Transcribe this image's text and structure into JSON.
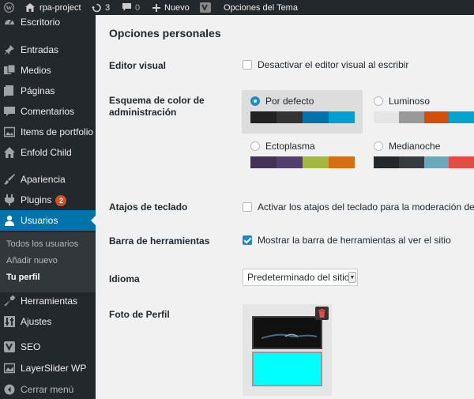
{
  "admin_bar": {
    "site_name": "rpa-project",
    "updates_count": "3",
    "comments_count": "0",
    "new_label": "Nuevo",
    "theme_options": "Opciones del Tema"
  },
  "sidebar": {
    "items": [
      {
        "label": "Escritorio",
        "icon": "dashboard-icon"
      },
      {
        "label": "Entradas",
        "icon": "pin-icon"
      },
      {
        "label": "Medios",
        "icon": "media-icon"
      },
      {
        "label": "Páginas",
        "icon": "pages-icon"
      },
      {
        "label": "Comentarios",
        "icon": "comment-icon"
      },
      {
        "label": "Items de portfolio",
        "icon": "portfolio-icon"
      },
      {
        "label": "Enfold Child",
        "icon": "home-icon"
      },
      {
        "label": "Apariencia",
        "icon": "brush-icon"
      },
      {
        "label": "Plugins",
        "icon": "plugin-icon",
        "badge": "2"
      },
      {
        "label": "Usuarios",
        "icon": "users-icon"
      },
      {
        "label": "Herramientas",
        "icon": "wrench-icon"
      },
      {
        "label": "Ajustes",
        "icon": "settings-icon"
      },
      {
        "label": "SEO",
        "icon": "yoast-icon"
      },
      {
        "label": "LayerSlider WP",
        "icon": "layers-icon"
      },
      {
        "label": "Cerrar menú",
        "icon": "collapse-icon"
      }
    ],
    "submenu": [
      {
        "label": "Todos los usuarios"
      },
      {
        "label": "Añadir nuevo"
      },
      {
        "label": "Tu perfil"
      }
    ]
  },
  "main": {
    "section_title": "Opciones personales",
    "visual_editor": {
      "label": "Editor visual",
      "option": "Desactivar el editor visual al escribir",
      "checked": false
    },
    "color_scheme": {
      "label": "Esquema de color de administración",
      "options": [
        {
          "name": "Por defecto",
          "selected": true,
          "colors": [
            "#222222",
            "#333333",
            "#0073aa",
            "#00a0d2"
          ]
        },
        {
          "name": "Luminoso",
          "selected": false,
          "colors": [
            "#e5e5e5",
            "#999999",
            "#d64e07",
            "#04a4cc"
          ]
        },
        {
          "name": "Ectoplasma",
          "selected": false,
          "colors": [
            "#413256",
            "#523f6d",
            "#a3b745",
            "#d46f15"
          ]
        },
        {
          "name": "Medianoche",
          "selected": false,
          "colors": [
            "#25282b",
            "#363b3f",
            "#69a8bb",
            "#e14d43"
          ]
        }
      ]
    },
    "keyboard_shortcuts": {
      "label": "Atajos de teclado",
      "option": "Activar los atajos del teclado para la moderación de co",
      "checked": false
    },
    "toolbar": {
      "label": "Barra de herramientas",
      "option": "Mostrar la barra de herramientas al ver el sitio",
      "checked": true
    },
    "language": {
      "label": "Idioma",
      "value": "Predeterminado del sitio"
    },
    "profile_photo": {
      "label": "Foto de Perfil"
    }
  },
  "colors": {
    "admin_bg": "#23282d",
    "accent": "#0073aa",
    "content_bg": "#f1f1f1",
    "badge": "#d54e21"
  }
}
